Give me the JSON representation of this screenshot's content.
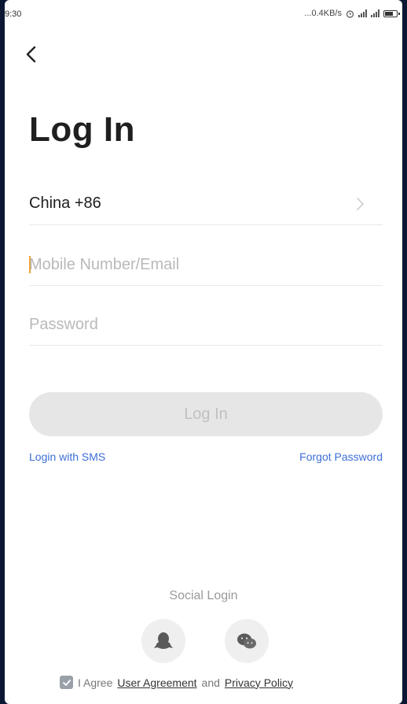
{
  "status_bar": {
    "time": "9:30",
    "network_speed": "...0.4KB/s"
  },
  "page": {
    "title": "Log In"
  },
  "form": {
    "country": "China +86",
    "account_placeholder": "Mobile Number/Email",
    "password_placeholder": "Password",
    "login_button": "Log In",
    "sms_login": "Login with SMS",
    "forgot_password": "Forgot Password"
  },
  "social": {
    "label": "Social Login",
    "providers": [
      "qq-icon",
      "wechat-icon"
    ]
  },
  "agreement": {
    "prefix": "I Agree",
    "user_agreement": "User Agreement",
    "conjunction": "and",
    "privacy_policy": "Privacy Policy",
    "checked": true
  },
  "colors": {
    "link": "#3d6fd6",
    "button_disabled_bg": "#e6e6e6",
    "caret": "#f0a030",
    "frame": "#0b1733"
  }
}
